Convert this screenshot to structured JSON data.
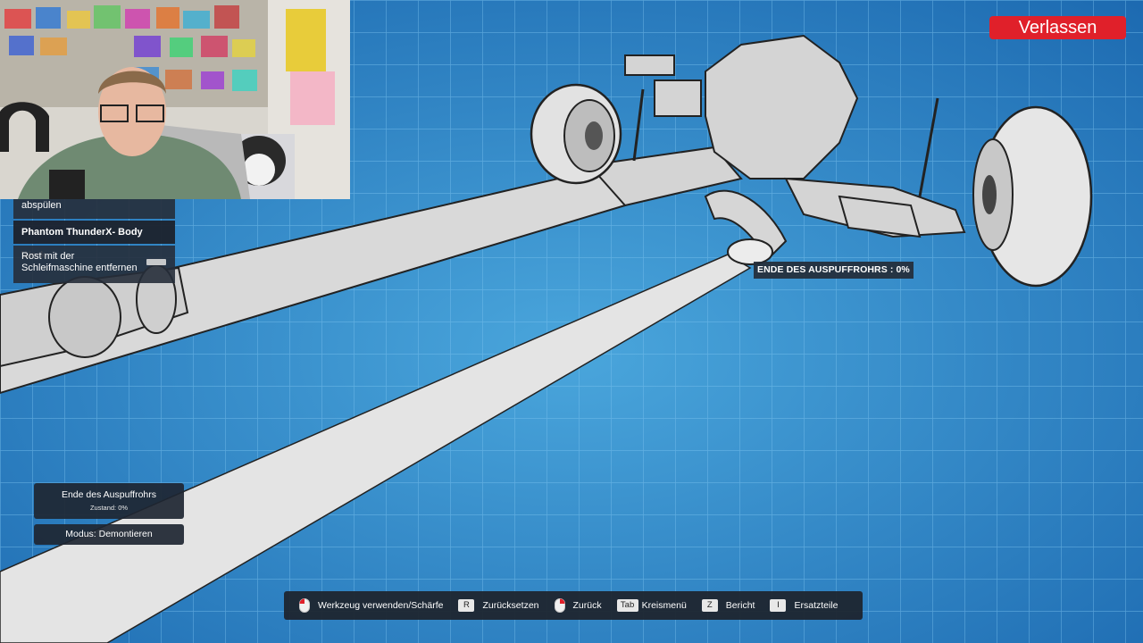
{
  "header": {
    "exit_label": "Verlassen"
  },
  "task_list": {
    "partial_task": "abspülen",
    "job_title": "Phantom ThunderX- Body Work",
    "current_task": "Rost mit der Schleifmaschine entfernen",
    "current_task_progress": 0.9
  },
  "part_tooltip": "ENDE DES AUSPUFFROHRS : 0%",
  "selected_part": {
    "name": "Ende des Auspuffrohrs",
    "condition": "Zustand: 0%"
  },
  "mode": "Modus: Demontieren",
  "hints": [
    {
      "key": "",
      "icon": "left-mouse-icon",
      "label": "Werkzeug verwenden/Schärfe"
    },
    {
      "key": "R",
      "icon": "",
      "label": "Zurücksetzen"
    },
    {
      "key": "",
      "icon": "right-mouse-icon",
      "label": "Zurück"
    },
    {
      "key": "Tab",
      "icon": "",
      "label": "Kreismenü"
    },
    {
      "key": "Z",
      "icon": "",
      "label": "Bericht"
    },
    {
      "key": "I",
      "icon": "",
      "label": "Ersatzteile"
    }
  ],
  "colors": {
    "exit_button": "#e0202a",
    "blueprint_bg": "#2f86c6",
    "panel_bg": "#262e3a"
  }
}
